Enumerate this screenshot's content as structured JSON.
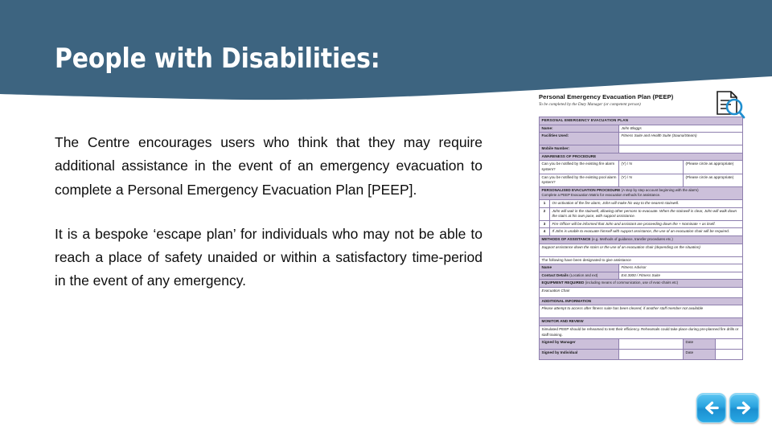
{
  "slide": {
    "title": "People with Disabilities:",
    "header_color": "#3d6480",
    "background_color": "#ffffff"
  },
  "body": {
    "paragraphs": [
      "The Centre encourages users who think that they may require additional assistance in the event of an emergency evacuation to complete a Personal Emergency Evacuation Plan [PEEP].",
      "It is a bespoke ‘escape plan’ for individuals who may not be able to reach a place of safety unaided or within a satisfactory time-period in the event of any emergency."
    ]
  },
  "peep_document": {
    "header_title": "Personal Emergency Evacuation Plan (PEEP)",
    "header_subtitle": "To be completed by the Duty Manager (or competent person)",
    "icon": "document-search-icon",
    "banner_title": "PERSONAL EMERGENCY EVACUATION PLAN",
    "accent_color": "#ccc0da",
    "entry_color": "#c0313a",
    "fields": {
      "name_label": "Name:",
      "name_value": "John Bloggs",
      "facilities_label": "Facilities Used:",
      "facilities_value": "Fitness Suite and Health Suite (Sauna/Steam)",
      "mobile_label": "Mobile Number:",
      "mobile_value": ""
    },
    "awareness": {
      "banner": "AWARENESS OF PROCEDURE",
      "q1": "Can you be notified by the existing fire alarm system?",
      "q1_answer": "(Y) / N",
      "q1_note": "(Please circle as appropriate)",
      "q2": "Can you be notified by the existing pool alarm system?",
      "q2_answer": "(Y) / N",
      "q2_note": "(Please circle as appropriate)"
    },
    "procedure": {
      "banner": "PERSONALISED EVACUATION PROCEDURE",
      "banner_note": "(A step by step account beginning with the alarm)",
      "banner_note2": "Complete a PEEP Evacuation Matrix for evacuation methods for assistance.",
      "steps": [
        {
          "n": "1",
          "text": "On activation of the fire alarm, John will make his way to the nearest stairwell."
        },
        {
          "n": "2",
          "text": "John will wait in the stairwell, allowing other persons to evacuate. When the stairwell is clear, John will walk down the stairs at his own pace, with support assistance."
        },
        {
          "n": "3",
          "text": "Fire Officer will be informed that John and assistant are proceeding down the  + Nominate + as itself."
        },
        {
          "n": "4",
          "text": "If John is unable to evacuate himself with support assistance, the use of an evacuation chair will be required."
        }
      ]
    },
    "assistance": {
      "banner": "METHODS OF ASSISTANCE",
      "banner_note": "(e.g. Methods of guidance, transfer procedures etc.)",
      "entry": "Support assistance down the stairs or the use of an evacuation chair (depending on the situation)",
      "designated_label": "The following have been designated to give assistance",
      "name_label": "Name",
      "name_value": "Fitness Advisor",
      "contact_label": "Contact Details",
      "contact_note": "(Location and ext)",
      "contact_value": "Ext 3000  /  Fitness Suite"
    },
    "equipment": {
      "banner": "EQUIPMENT REQUIRED",
      "banner_note": "(including means of communication, use of evac-chairs etc)",
      "entry": "Evacuation Chair"
    },
    "additional": {
      "banner": "ADDITIONAL INFORMATION",
      "entry": "Please attempt to access after fitness suite has been cleared, if another staff member not available"
    },
    "monitor": {
      "banner": "MONITOR AND REVIEW",
      "note": "Simulated PEEP should be rehearsed to test their efficiency. Rehearsals could take place during pre-planned fire drills or staff training.",
      "rows": [
        {
          "label": "Signed by Manager",
          "value": "",
          "date_label": "Date",
          "date_value": ""
        },
        {
          "label": "Signed by Individual",
          "value": "",
          "date_label": "Date",
          "date_value": ""
        }
      ]
    }
  },
  "navigation": {
    "previous_label": "Previous slide",
    "next_label": "Next slide",
    "button_color": "#2ba4e0"
  }
}
